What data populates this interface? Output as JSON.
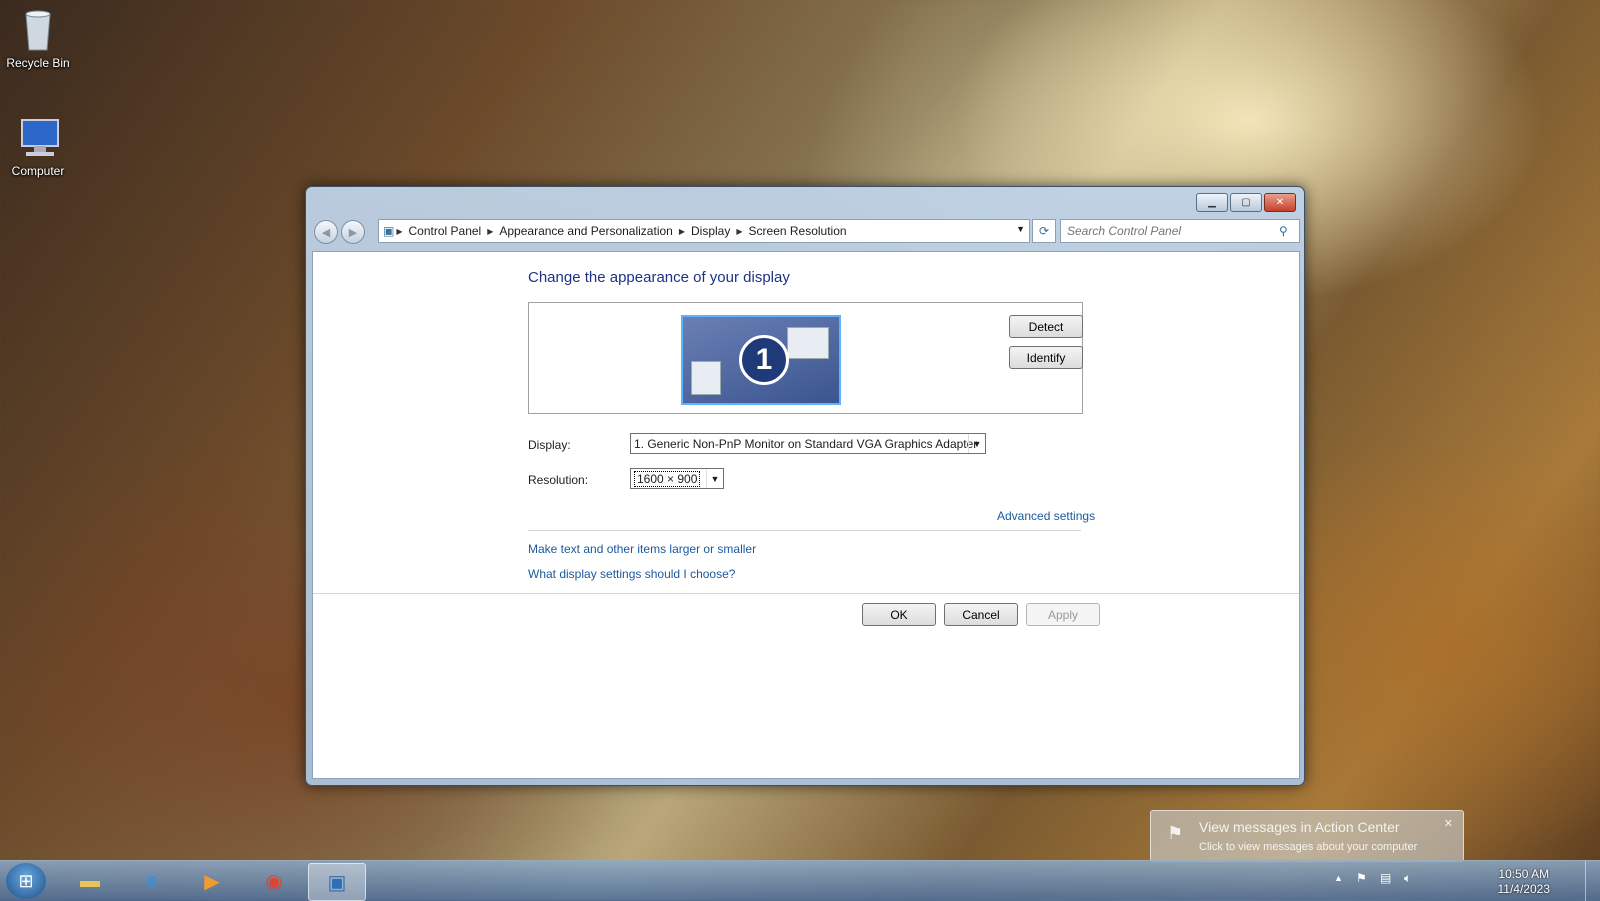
{
  "desktop": {
    "icons": [
      {
        "label": "Recycle Bin",
        "icon": "recycle-bin-icon"
      },
      {
        "label": "Computer",
        "icon": "computer-icon"
      }
    ]
  },
  "window": {
    "breadcrumb": [
      "Control Panel",
      "Appearance and Personalization",
      "Display",
      "Screen Resolution"
    ],
    "search_placeholder": "Search Control Panel",
    "heading": "Change the appearance of your display",
    "monitor_number": "1",
    "detect_label": "Detect",
    "identify_label": "Identify",
    "display_label": "Display:",
    "display_value": "1. Generic Non-PnP Monitor on Standard VGA Graphics Adapter",
    "resolution_label": "Resolution:",
    "resolution_value": "1600 × 900",
    "advanced_link": "Advanced settings",
    "text_size_link": "Make text and other items larger or smaller",
    "help_link": "What display settings should I choose?",
    "ok_label": "OK",
    "cancel_label": "Cancel",
    "apply_label": "Apply"
  },
  "toast": {
    "title": "View messages in Action Center",
    "subtitle": "Click to view messages about your computer"
  },
  "taskbar": {
    "time": "10:50 AM",
    "date": "11/4/2023",
    "apps": [
      "explorer-icon",
      "internet-explorer-icon",
      "media-player-icon",
      "chrome-icon",
      "control-panel-icon"
    ]
  },
  "colors": {
    "heading": "#1e3287",
    "link": "#1b5a9c"
  }
}
